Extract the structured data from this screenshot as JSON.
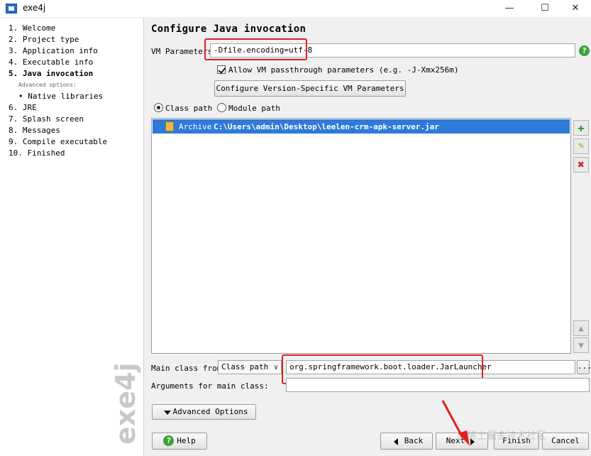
{
  "window": {
    "title": "exe4j",
    "minimize": "—",
    "maximize": "☐",
    "close": "✕"
  },
  "steps": [
    {
      "label": "1.  Welcome"
    },
    {
      "label": "2.  Project type"
    },
    {
      "label": "3.  Application info"
    },
    {
      "label": "4.  Executable info"
    },
    {
      "label": "5.  Java invocation"
    },
    {
      "label": "Advanced options:"
    },
    {
      "label": "• Native libraries"
    },
    {
      "label": "6.  JRE"
    },
    {
      "label": "7.  Splash screen"
    },
    {
      "label": "8.  Messages"
    },
    {
      "label": "9.  Compile executable"
    },
    {
      "label": "10.  Finished"
    }
  ],
  "sidebar_watermark": "exe4j",
  "main": {
    "title": "Configure Java invocation",
    "vm_label": "VM Parameters:",
    "vm_value": "-Dfile.encoding=utf-8",
    "passthrough_label": "Allow VM passthrough parameters (e.g. -J-Xmx256m)",
    "version_button": "Configure Version-Specific VM Parameters",
    "classpath_radio": "Class path",
    "modulepath_radio": "Module path",
    "archive_prefix": "Archive",
    "archive_path": "C:\\Users\\admin\\Desktop\\leelen-crm-apk-server.jar",
    "main_class_label": "Main class from",
    "main_class_source": "Class path",
    "main_class_value": "org.springframework.boot.loader.JarLauncher",
    "browse_button": "...",
    "args_label": "Arguments for main class:",
    "args_value": "",
    "advanced_button": "Advanced Options"
  },
  "footer": {
    "help": "Help",
    "back": "Back",
    "next": "Next",
    "finish": "Finish",
    "cancel": "Cancel",
    "overlay_text": "@稀土掘金技术社区"
  },
  "colors": {
    "accent": "#2f7ad8",
    "highlight": "#e02020",
    "add": "#3aa13a"
  }
}
